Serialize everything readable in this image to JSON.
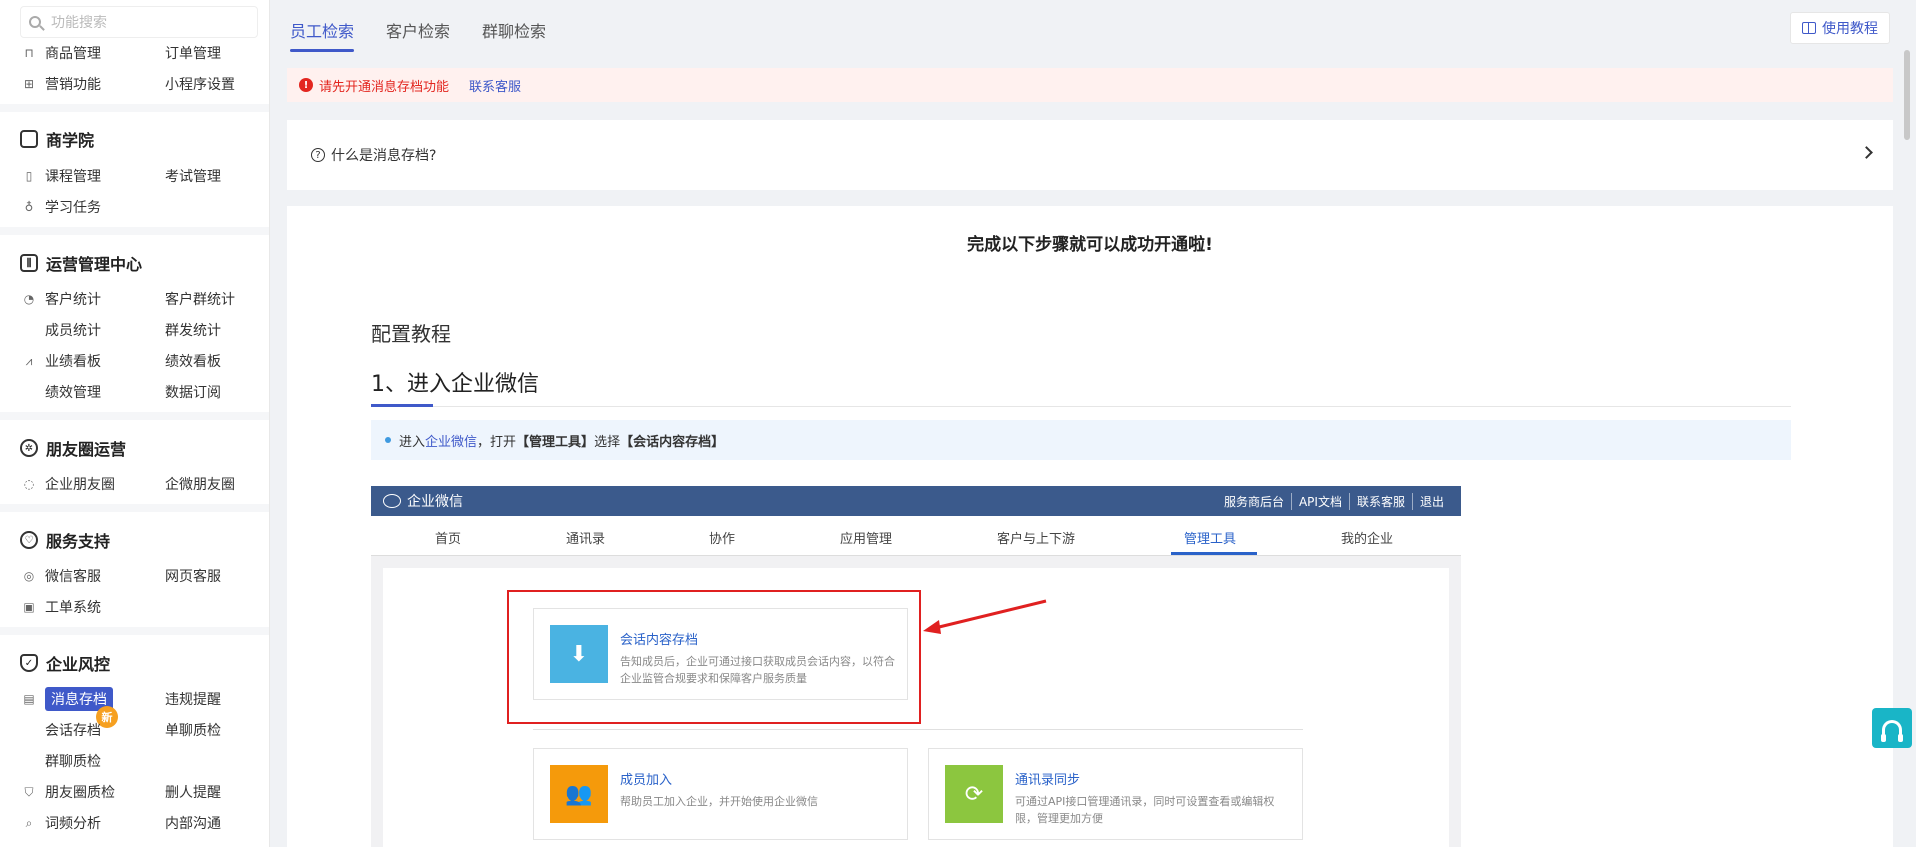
{
  "sidebar": {
    "search_placeholder": "功能搜索",
    "top_items": [
      {
        "label": "商品管理",
        "icon": "bag-icon"
      },
      {
        "label": "订单管理",
        "icon": ""
      },
      {
        "label": "营销功能",
        "icon": "gift-icon"
      },
      {
        "label": "小程序设置",
        "icon": ""
      }
    ],
    "sections": [
      {
        "title": "商学院",
        "icon": "book-icon",
        "items": [
          "课程管理",
          "考试管理",
          "学习任务"
        ]
      },
      {
        "title": "运营管理中心",
        "icon": "sliders-icon",
        "items": [
          "客户统计",
          "客户群统计",
          "成员统计",
          "群发统计",
          "业绩看板",
          "绩效看板",
          "绩效管理",
          "数据订阅"
        ]
      },
      {
        "title": "朋友圈运营",
        "icon": "aperture-icon",
        "items": [
          "企业朋友圈",
          "企微朋友圈"
        ]
      },
      {
        "title": "服务支持",
        "icon": "heart-icon",
        "items": [
          "微信客服",
          "网页客服",
          "工单系统"
        ]
      },
      {
        "title": "企业风控",
        "icon": "shield-icon",
        "items": [
          "消息存档",
          "违规提醒",
          "会话存档",
          "单聊质检",
          "群聊质检",
          "朋友圈质检",
          "删人提醒",
          "词频分析",
          "内部沟通"
        ]
      }
    ],
    "new_badge": "新"
  },
  "tabs": [
    "员工检索",
    "客户检索",
    "群聊检索"
  ],
  "help_button": "使用教程",
  "alert": {
    "text": "请先开通消息存档功能",
    "link": "联系客服"
  },
  "faq": {
    "question": "什么是消息存档?"
  },
  "card": {
    "title": "完成以下步骤就可以成功开通啦!",
    "tutorial_title": "配置教程",
    "step_title": "1、进入企业微信",
    "tip": {
      "prefix": "进入",
      "link": "企业微信",
      "middle": "，打开 ",
      "bold1": "【管理工具】",
      "middle2": "选择",
      "bold2": "【会话内容存档】"
    }
  },
  "shot": {
    "brand": "企业微信",
    "links": [
      "服务商后台",
      "API文档",
      "联系客服",
      "退出"
    ],
    "nav": [
      "首页",
      "通讯录",
      "协作",
      "应用管理",
      "客户与上下游",
      "管理工具",
      "我的企业"
    ],
    "active_nav": "管理工具",
    "tiles": [
      {
        "title": "会话内容存档",
        "desc": "告知成员后，企业可通过接口获取成员会话内容，以符合企业监管合规要求和保障客户服务质量",
        "color": "#4ab3e2"
      },
      {
        "title": "成员加入",
        "desc": "帮助员工加入企业，并开始使用企业微信",
        "color": "#f59a0b"
      },
      {
        "title": "通讯录同步",
        "desc": "可通过API接口管理通讯录，同时可设置查看或编辑权限，管理更加方便",
        "color": "#8cc63f"
      }
    ]
  },
  "colors": {
    "accent": "#3f59c9",
    "alert": "#e3261f",
    "float": "#19b5c7"
  }
}
